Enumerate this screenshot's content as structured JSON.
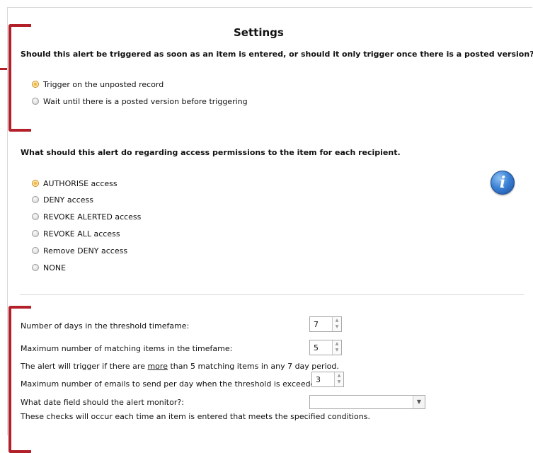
{
  "title": "Settings",
  "trigger_section": {
    "question": "Should this alert be triggered as soon as an item is entered, or should it only trigger once there is a posted version?",
    "options": [
      {
        "label": "Trigger on the unposted record",
        "checked": true
      },
      {
        "label": "Wait until there is a posted version before triggering",
        "checked": false
      }
    ]
  },
  "permissions_section": {
    "question": "What should this alert do regarding access permissions to the item for each recipient.",
    "options": [
      {
        "label": "AUTHORISE access",
        "checked": true
      },
      {
        "label": "DENY access",
        "checked": false
      },
      {
        "label": "REVOKE ALERTED access",
        "checked": false
      },
      {
        "label": "REVOKE ALL access",
        "checked": false
      },
      {
        "label": "Remove DENY access",
        "checked": false
      },
      {
        "label": "NONE",
        "checked": false
      }
    ],
    "info_icon": "info-icon"
  },
  "threshold_section": {
    "days_label": "Number of days in the threshold timefame:",
    "days_value": "7",
    "max_items_label": "Maximum number of matching items in the timefame:",
    "max_items_value": "5",
    "trigger_info_pre": "The alert will trigger if there are ",
    "trigger_info_underlined": "more",
    "trigger_info_post": " than 5 matching items in any 7 day period.",
    "max_emails_label": "Maximum number of emails to send per day when the threshold is exceeded:",
    "max_emails_value": "3",
    "date_field_label": "What date field should the alert monitor?:",
    "date_field_value": "",
    "checks_info": "These checks will occur each time an item is entered that meets the specified conditions."
  },
  "colors": {
    "bracket": "#b3202a",
    "radio_selected": "#f0a826",
    "info_icon": "#3b82d6"
  }
}
